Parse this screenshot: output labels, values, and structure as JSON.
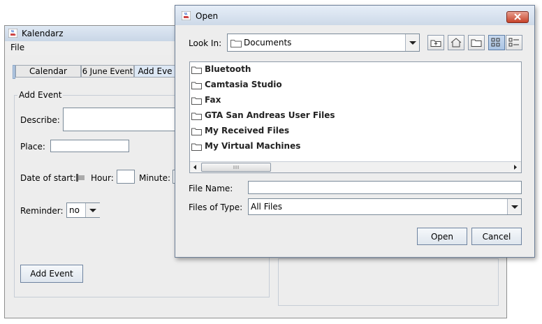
{
  "background_window": {
    "title": "Kalendarz",
    "menu": {
      "file": "File"
    },
    "tabs": [
      {
        "label": "Calendar",
        "selected": false
      },
      {
        "label": "6 June Event",
        "selected": false
      },
      {
        "label": "Add Eve",
        "selected": true
      }
    ],
    "form": {
      "group_title": "Add Event",
      "describe_label": "Describe:",
      "place_label": "Place:",
      "date_label": "Date of start:",
      "hour_label": "Hour:",
      "minute_label": "Minute:",
      "reminder_label": "Reminder:",
      "reminder_value": "no",
      "add_button": "Add Event"
    }
  },
  "dialog": {
    "title": "Open",
    "close_icon": "close-icon",
    "look_in_label": "Look In:",
    "look_in_value": "Documents",
    "toolbar_icons": [
      "up-folder-icon",
      "home-icon",
      "new-folder-icon",
      "list-view-icon",
      "details-view-icon"
    ],
    "files": [
      {
        "name": "Bluetooth"
      },
      {
        "name": "Camtasia Studio"
      },
      {
        "name": "Fax"
      },
      {
        "name": "GTA San Andreas User Files"
      },
      {
        "name": "My Received Files"
      },
      {
        "name": "My Virtual Machines"
      }
    ],
    "file_name_label": "File Name:",
    "file_name_value": "",
    "files_of_type_label": "Files of Type:",
    "files_of_type_value": "All Files",
    "open_button": "Open",
    "cancel_button": "Cancel"
  }
}
